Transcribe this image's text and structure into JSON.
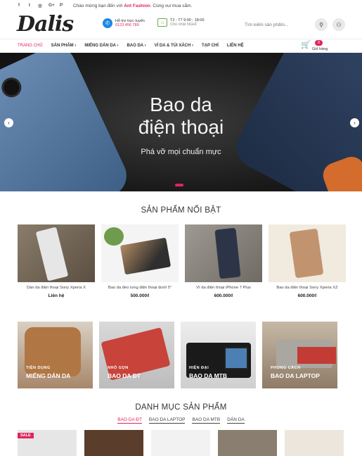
{
  "topbar": {
    "social": [
      "f",
      "t",
      "◎",
      "G+",
      "P"
    ],
    "greeting_prefix": "Chào mừng bạn đến với",
    "brand": "Ant Fashion",
    "greeting_suffix": ". Cùng vui mua sắm."
  },
  "header": {
    "logo": "Dalis",
    "support_title": "Hỗ trợ trực tuyến",
    "support_phone": "0123 456 789",
    "hours_title": "T2 - T7 9:00 - 18:00",
    "hours_note": "Chủ nhật NGHỈ",
    "search_placeholder": "Tìm kiếm sản phẩm..."
  },
  "nav": {
    "items": [
      "TRANG CHỦ",
      "SẢN PHẨM ›",
      "MIẾNG DÁN DA ›",
      "BAO DA ›",
      "VÍ DA & TÚI XÁCH ›",
      "TẠP CHÍ",
      "LIÊN HỆ"
    ]
  },
  "cart": {
    "count": "0",
    "label": "Giỏ hàng"
  },
  "hero": {
    "title_line1": "Bao da",
    "title_line2": "điện thoại",
    "subtitle": "Phá vỡ mọi chuẩn mực"
  },
  "featured": {
    "title": "SẢN PHẨM NỔI BẬT",
    "products": [
      {
        "name": "Dán da điện thoại Sony Xperia X",
        "price": "Liên hệ"
      },
      {
        "name": "Bao da đeo lưng điện thoại dưới 5\"",
        "price": "500.000₫"
      },
      {
        "name": "Ví da điện thoại iPhone 7 Plus",
        "price": "600.000₫"
      },
      {
        "name": "Bao da điện thoại Sony Xperia XZ",
        "price": "600.000₫"
      }
    ]
  },
  "categories": [
    {
      "small": "TIỆN DỤNG",
      "big": "MIẾNG DÁN DA"
    },
    {
      "small": "NHỎ GỌN",
      "big": "BAO DA ĐT"
    },
    {
      "small": "HIỆN ĐẠI",
      "big": "BAO DA MTB"
    },
    {
      "small": "PHONG CÁCH",
      "big": "BAO DA LAPTOP"
    }
  ],
  "catalog": {
    "title": "DANH MỤC SẢN PHẨM",
    "tabs": [
      "BAO DA ĐT",
      "BAO DA LAPTOP",
      "BAO DA MTB",
      "DÁN DA"
    ],
    "sale_label": "SALE"
  },
  "colors": {
    "accent": "#e0245e"
  }
}
